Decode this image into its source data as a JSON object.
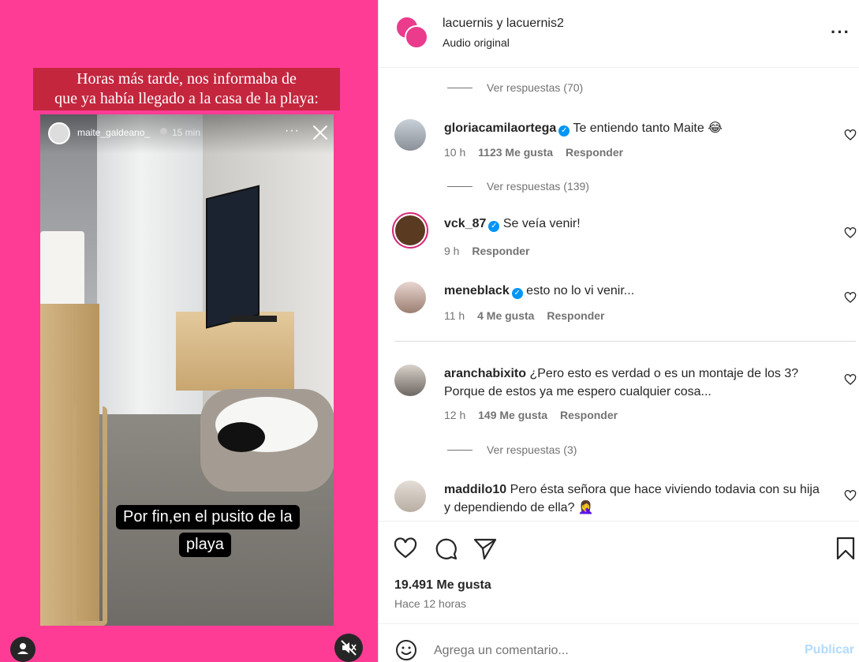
{
  "media": {
    "caption_line1": "Horas más tarde, nos informaba de",
    "caption_line2": "que ya había llegado a la casa de la playa:",
    "story": {
      "username": "maite_galdeano_",
      "time": "15 min",
      "more": "···",
      "subtitle_line1": "Por fin,en el pusito de la",
      "subtitle_line2": "playa"
    },
    "background_color": "#fe3c96",
    "caption_bg_color": "#c4263e"
  },
  "header": {
    "title": "lacuernis y lacuernis2",
    "subtitle": "Audio original",
    "more": "···"
  },
  "comments": [
    {
      "type": "replies",
      "label": "Ver respuestas (70)"
    },
    {
      "type": "comment",
      "username": "gloriacamilaortega",
      "verified": true,
      "text": "Te entiendo tanto Maite 😂",
      "time": "10 h",
      "likes": "1123 Me gusta",
      "reply": "Responder"
    },
    {
      "type": "replies",
      "label": "Ver respuestas (139)"
    },
    {
      "type": "comment",
      "username": "vck_87",
      "verified": true,
      "text": "Se veía venir!",
      "time": "9 h",
      "likes": "",
      "reply": "Responder"
    },
    {
      "type": "comment",
      "username": "meneblack",
      "verified": true,
      "text": "esto no lo vi venir...",
      "time": "11 h",
      "likes": "4 Me gusta",
      "reply": "Responder"
    },
    {
      "type": "comment",
      "username": "aranchabixito",
      "verified": false,
      "text": "¿Pero esto es verdad o es un montaje de los 3? Porque de estos ya me espero cualquier cosa...",
      "time": "12 h",
      "likes": "149 Me gusta",
      "reply": "Responder"
    },
    {
      "type": "replies",
      "label": "Ver respuestas (3)"
    },
    {
      "type": "comment",
      "username": "maddilo10",
      "verified": false,
      "text": "Pero ésta señora que hace viviendo todavia con su hija y dependiendo de ella? 🤦‍♀️",
      "time": "",
      "likes": "",
      "reply": ""
    }
  ],
  "actions": {
    "likes": "19.491 Me gusta",
    "time": "Hace 12 horas",
    "icons": [
      "heart-icon",
      "comment-icon",
      "share-icon",
      "bookmark-icon"
    ]
  },
  "composer": {
    "placeholder": "Agrega un comentario...",
    "publish": "Publicar"
  },
  "colors": {
    "link_blue": "#0095f6",
    "publish_disabled": "#b3dbff",
    "secondary_text": "#737373"
  }
}
